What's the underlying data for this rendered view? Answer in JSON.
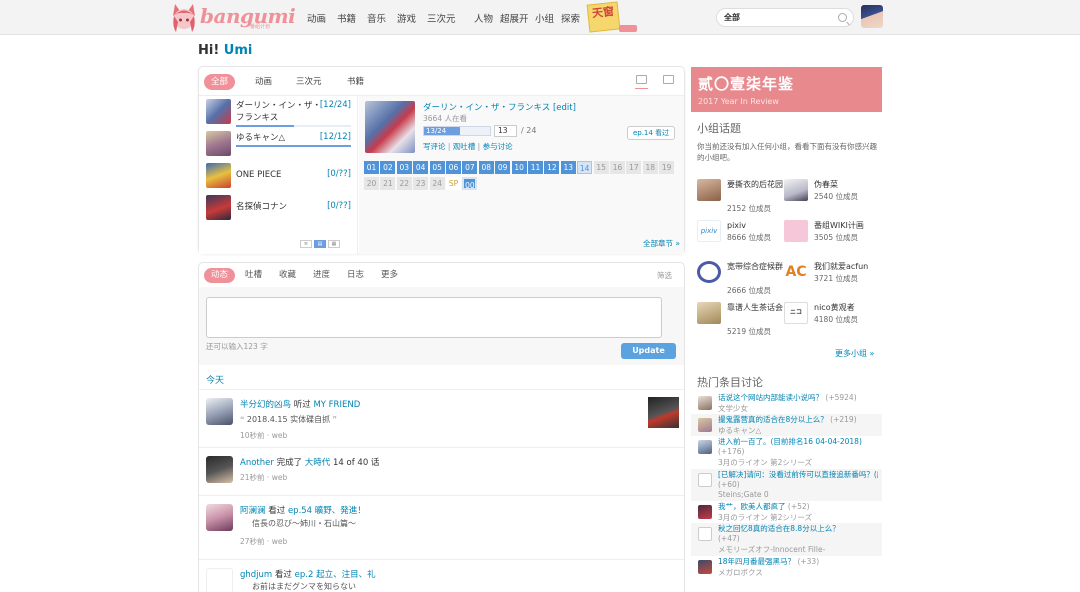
{
  "header": {
    "logo_text": "bangumi",
    "logo_sub": "番组计划",
    "nav": [
      "动画",
      "书籍",
      "音乐",
      "游戏",
      "三次元",
      "人物",
      "超展开",
      "小组",
      "探索"
    ],
    "tenma": "天窗",
    "search": {
      "scope": "全部",
      "placeholder": ""
    }
  },
  "greeting": {
    "prefix": "Hi!",
    "name": "Umi"
  },
  "progress_panel": {
    "tabs": [
      "全部",
      "动画",
      "三次元",
      "书籍"
    ],
    "subjects": [
      {
        "name": "ダーリン・イン・ザ・フランキス",
        "progress": "[12/24]",
        "ratio": 0.5
      },
      {
        "name": "ゆるキャン△",
        "progress": "[12/12]",
        "ratio": 1.0
      },
      {
        "name": "ONE PIECE",
        "progress": "[0/??]",
        "ratio": 0
      },
      {
        "name": "名探偵コナン",
        "progress": "[0/??]",
        "ratio": 0
      }
    ],
    "list_modes": [
      "list",
      "tile",
      "grid"
    ],
    "detail": {
      "title": "ダーリン・イン・ザ・フランキス",
      "edit": "[edit]",
      "watching": "3664 人在看",
      "progress_label": "13/24",
      "progress_ratio": 0.54,
      "progress_input": "13",
      "progress_total": "/ 24",
      "links": [
        "写评论",
        "观吐槽",
        "参与讨论"
      ],
      "watched_button": "ep.14 看过",
      "episodes_row1": [
        "01",
        "02",
        "03",
        "04",
        "05",
        "06",
        "07",
        "08",
        "09",
        "10",
        "11",
        "12",
        "13",
        "14",
        "15",
        "16",
        "17",
        "18",
        "19"
      ],
      "episodes_row2": [
        "20",
        "21",
        "22",
        "23",
        "24",
        "SP",
        "00"
      ],
      "all_episodes": "全部章节 »"
    }
  },
  "timeline": {
    "tabs": [
      "动态",
      "吐槽",
      "收藏",
      "进度",
      "日志",
      "更多"
    ],
    "filter": "筛选",
    "input_placeholder": "",
    "chars_left": "还可以输入123 字",
    "update": "Update",
    "today": "今天",
    "items": [
      {
        "user": "半分幻的凶鸟",
        "action": "听过",
        "target": "MY FRIEND",
        "sub": "2018.4.15 实体碟自抓",
        "meta": "10秒前 · web"
      },
      {
        "user": "Another",
        "action": "完成了",
        "target": "大時代",
        "rest": "14 of 40 话",
        "sub": "",
        "meta": "21秒前 · web"
      },
      {
        "user": "阿澜澜",
        "action": "看过",
        "target": "ep.54 曠野、発進！",
        "sub": "信長の忍び～姉川・石山篇～",
        "meta": "27秒前 · web"
      },
      {
        "user": "ghdjum",
        "action": "看过",
        "target": "ep.2 起立、注目、礼",
        "sub": "お前はまだグンマを知らない",
        "meta": ""
      }
    ]
  },
  "year_in_review": {
    "title": "贰〇壹柒年鉴",
    "subtitle": "2017 Year In Review"
  },
  "groups": {
    "heading": "小组话题",
    "description": "你当前还没有加入任何小组，看看下面有没有你感兴趣的小组吧。",
    "items": [
      {
        "name": "要撕衣的后花园",
        "members": "2152 位成员"
      },
      {
        "name": "伪春菜",
        "members": "2540 位成员"
      },
      {
        "name": "pixiv",
        "members": "8666 位成员"
      },
      {
        "name": "番组WIKI计画",
        "members": "3505 位成员"
      },
      {
        "name": "宽带综合症候群",
        "members": "2666 位成员"
      },
      {
        "name": "我们就爱acfun",
        "members": "3721 位成员"
      },
      {
        "name": "靠谱人生茶话会",
        "members": "5219 位成员"
      },
      {
        "name": "nico黄观者",
        "members": "4180 位成员"
      }
    ],
    "more": "更多小组 »"
  },
  "hot": {
    "heading": "热门条目讨论",
    "items": [
      {
        "title": "话说这个网站内部能读小说吗？",
        "count": "(+5924)",
        "sub": "文学少女"
      },
      {
        "title": "撮鬼露营真的适合在8分以上么？",
        "count": "(+219)",
        "sub": "ゆるキャン△"
      },
      {
        "title": "进入前一百了。(目前排名16 04-04-2018)",
        "count": "(+176)",
        "sub": "3月のライオン 第2シリーズ"
      },
      {
        "title": "[已解决]请问：没看过前传可以直接追新番吗？(应该不能",
        "count": "(+60)",
        "sub": "Steins;Gate 0"
      },
      {
        "title": "我艹，欧美人都疯了",
        "count": "(+52)",
        "sub": "3月のライオン 第2シリーズ"
      },
      {
        "title": "秋之回忆8真的适合在8.8分以上么？",
        "count": "(+47)",
        "sub": "メモリーズオフ-Innocent Fille-"
      },
      {
        "title": "18年四月番最强黑马？",
        "count": "(+33)",
        "sub": "メガロボクス"
      }
    ]
  }
}
